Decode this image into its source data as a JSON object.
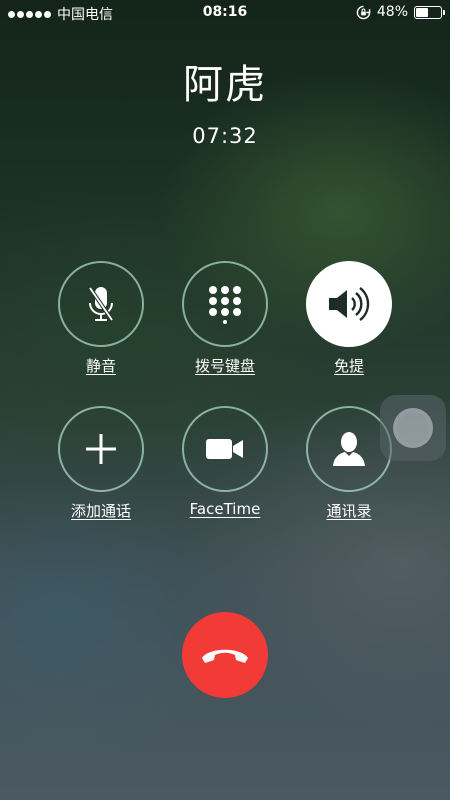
{
  "status_bar": {
    "carrier": "中国电信",
    "time": "08:16",
    "battery_percent": "48%",
    "battery_level": 0.48,
    "icons": [
      "signal-dots-icon",
      "rotation-lock-icon",
      "battery-icon"
    ]
  },
  "call": {
    "caller_name": "阿虎",
    "duration": "07:32"
  },
  "buttons": {
    "mute": {
      "label": "静音",
      "icon": "mic-muted-icon",
      "active": false
    },
    "keypad": {
      "label": "拨号键盘",
      "icon": "keypad-icon",
      "active": false
    },
    "speaker": {
      "label": "免提",
      "icon": "speaker-icon",
      "active": true
    },
    "add_call": {
      "label": "添加通话",
      "icon": "plus-icon",
      "active": false
    },
    "facetime": {
      "label": "FaceTime",
      "icon": "video-camera-icon",
      "active": false
    },
    "contacts": {
      "label": "通讯录",
      "icon": "contact-person-icon",
      "active": false
    }
  },
  "end_call": {
    "icon": "phone-hangup-icon",
    "color": "#f23b36"
  },
  "colors": {
    "ring": "#aad7c8",
    "active_fill": "#ffffff",
    "end_call": "#f23b36"
  }
}
